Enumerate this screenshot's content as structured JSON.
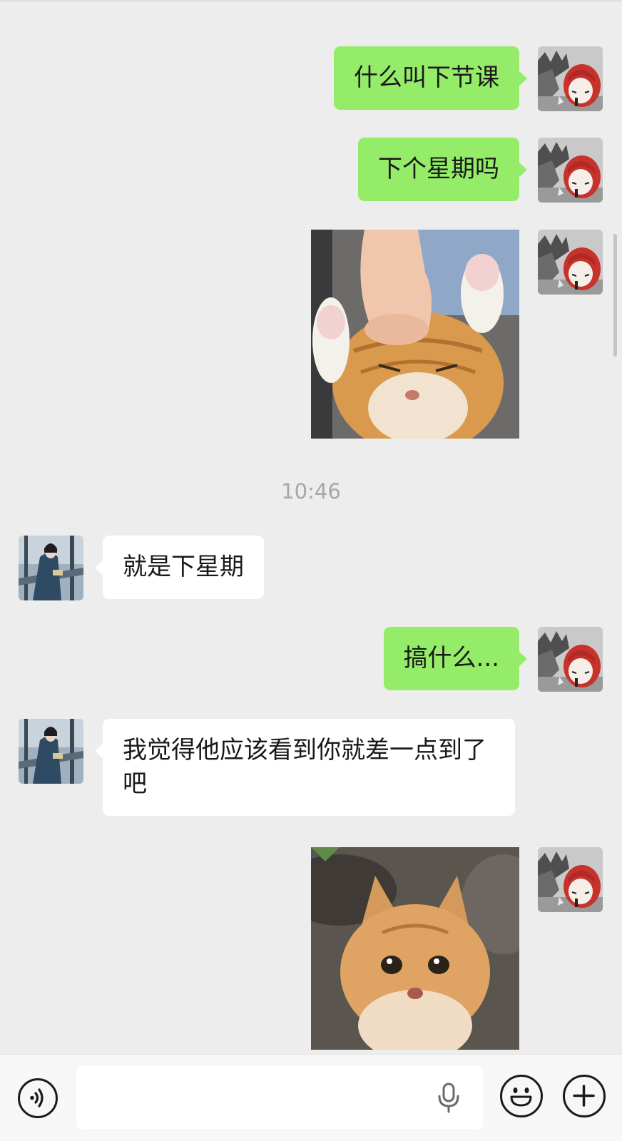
{
  "messages": {
    "m1": "什么叫下节课",
    "m2": "下个星期吗",
    "m4": "就是下星期",
    "m5": "搞什么...",
    "m6": "我觉得他应该看到你就差一点到了吧"
  },
  "timestamp": "10:46",
  "input": {
    "value": "",
    "placeholder": ""
  },
  "colors": {
    "self_bubble": "#95ec69",
    "other_bubble": "#ffffff",
    "background": "#ededed"
  },
  "icons": {
    "voice": "voice-mode-icon",
    "mic": "microphone-icon",
    "emoji": "emoji-icon",
    "plus": "plus-icon"
  }
}
